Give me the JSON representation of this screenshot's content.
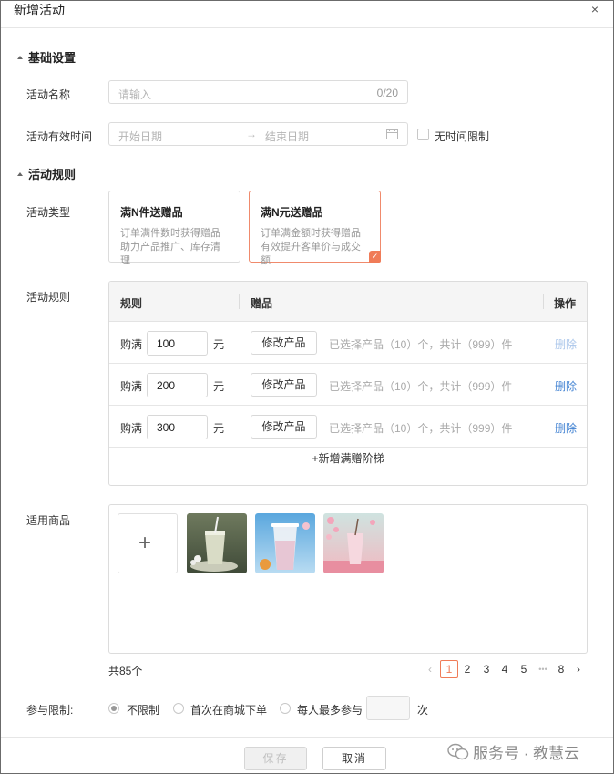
{
  "dialog": {
    "title": "新增活动",
    "close_label": "×"
  },
  "basic": {
    "section_title": "基础设置",
    "name_label": "活动名称",
    "name_placeholder": "请输入",
    "name_count": "0/20",
    "time_label": "活动有效时间",
    "start_placeholder": "开始日期",
    "arrow": "→",
    "end_placeholder": "结束日期",
    "no_limit_label": "无时间限制"
  },
  "rules": {
    "section_title": "活动规则",
    "type_label": "活动类型",
    "type_cards": [
      {
        "title": "满N件送赠品",
        "desc1": "订单满件数时获得赠品",
        "desc2": "助力产品推广、库存清理",
        "selected": false
      },
      {
        "title": "满N元送赠品",
        "desc1": "订单满金额时获得赠品",
        "desc2": "有效提升客单价与成交额",
        "selected": true
      }
    ],
    "rule_label": "活动规则",
    "table": {
      "headers": [
        "规则",
        "赠品",
        "操作"
      ],
      "rows": [
        {
          "prefix": "购满",
          "amount": "100",
          "unit": "元",
          "modify": "修改产品",
          "info": "已选择产品（10）个，共计（999）件",
          "action": "删除",
          "action_disabled": true
        },
        {
          "prefix": "购满",
          "amount": "200",
          "unit": "元",
          "modify": "修改产品",
          "info": "已选择产品（10）个，共计（999）件",
          "action": "删除",
          "action_disabled": false
        },
        {
          "prefix": "购满",
          "amount": "300",
          "unit": "元",
          "modify": "修改产品",
          "info": "已选择产品（10）个，共计（999）件",
          "action": "删除",
          "action_disabled": false
        }
      ],
      "add_tier": "+新增满赠阶梯"
    }
  },
  "goods": {
    "label": "适用商品",
    "add_symbol": "+",
    "thumbnails": [
      "matcha-drink",
      "iced-tea-cup",
      "pink-drink"
    ]
  },
  "pagination": {
    "total": "共85个",
    "prev": "‹",
    "pages": [
      "1",
      "2",
      "3",
      "4",
      "5"
    ],
    "ellipsis": "•••",
    "last": "8",
    "next": "›",
    "current": "1"
  },
  "participation": {
    "label": "参与限制:",
    "options": [
      "不限制",
      "首次在商城下单",
      "每人最多参与"
    ],
    "selected": "不限制",
    "times_suffix": "次"
  },
  "footer": {
    "save": "保存",
    "cancel": "取消"
  },
  "watermark": {
    "text": "服务号 · 教慧云"
  },
  "colors": {
    "accent": "#f07c58",
    "link": "#3d7fd1",
    "border": "#dcdcdc"
  }
}
